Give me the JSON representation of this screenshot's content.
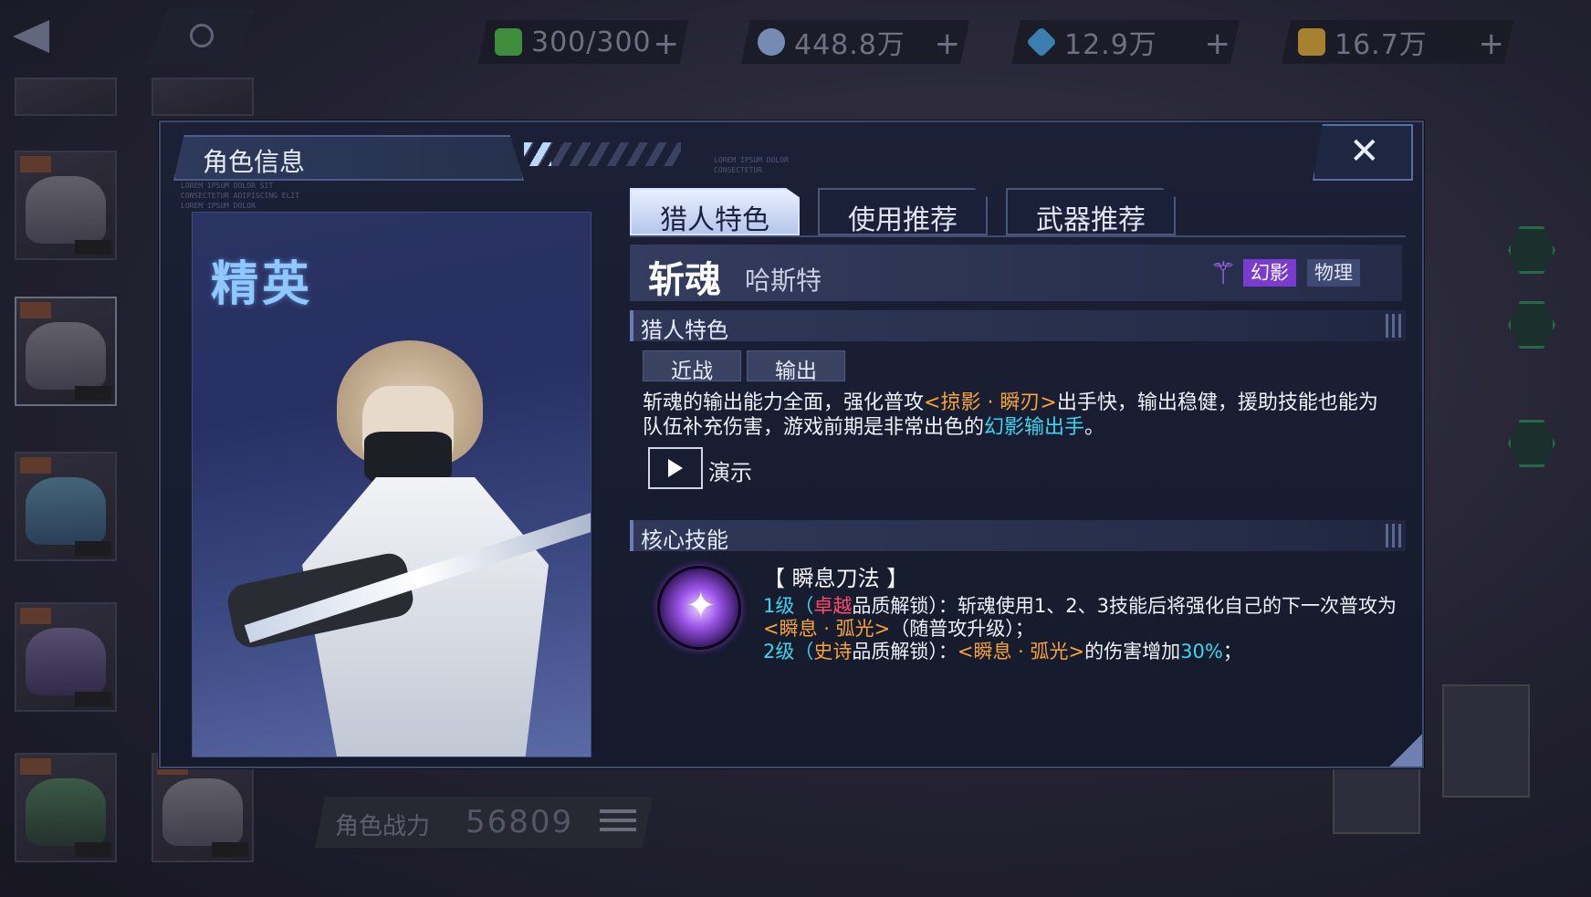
{
  "topbar": {
    "resources": [
      {
        "icon": "stamina-icon",
        "value": "300/300",
        "color": "#4fb84a"
      },
      {
        "icon": "crystal-icon",
        "value": "448.8万",
        "color": "#9ab6e6"
      },
      {
        "icon": "diamond-icon",
        "value": "12.9万",
        "color": "#4aa6e0"
      },
      {
        "icon": "gold-coin-icon",
        "value": "16.7万",
        "color": "#d9a83a"
      }
    ],
    "plus": "+"
  },
  "background": {
    "power_label": "角色战力",
    "power_value": "56809"
  },
  "dialog": {
    "title": "角色信息",
    "deco_text_1": "LOREM IPSUM DOLOR\nCONSECTETUR",
    "deco_text_2": "LOREM IPSUM DOLOR SIT\nCONSECTETUR ADIPISCING ELIT\nLOREM IPSUM DOLOR",
    "close": "✕",
    "rank": "精英",
    "tabs": [
      "猎人特色",
      "使用推荐",
      "武器推荐"
    ],
    "active_tab": 0,
    "character": {
      "name": "斩魂",
      "subname": "哈斯特",
      "class_icon": "phantom-class-icon",
      "badges": [
        "幻影",
        "物理"
      ]
    },
    "feature_section": {
      "heading": "猎人特色",
      "chips": [
        "近战",
        "输出"
      ],
      "desc": {
        "p1": "斩魂的输出能力全面，强化普攻",
        "hl1": "<掠影 · 瞬刃>",
        "p2": "出手快，输出稳健，援助技能也能为队伍补充伤害，游戏前期是非常出色的",
        "hl2": "幻影输出手",
        "p3": "。"
      },
      "demo_label": "演示"
    },
    "core_skill": {
      "heading": "核心技能",
      "skill_name": "【 瞬息刀法 】",
      "line1": {
        "lv": "1级（",
        "quality": "卓越",
        "mid": "品质解锁）：斩魂使用1、2、3技能后将强化自己的下一次普攻为",
        "hl": "<瞬息 · 弧光>",
        "end": "（随普攻升级）；"
      },
      "line2": {
        "lv": "2级（",
        "quality": "史诗",
        "mid": "品质解锁）：",
        "hl": "<瞬息 · 弧光>",
        "mid2": "的伤害增加",
        "pct": "30%",
        "end": "；"
      }
    }
  },
  "colors": {
    "accent_orange": "#f5a43a",
    "accent_cyan": "#38d6f0",
    "rank_blue": "#8fc8ff",
    "phantom_purple": "#7a3ccf"
  }
}
